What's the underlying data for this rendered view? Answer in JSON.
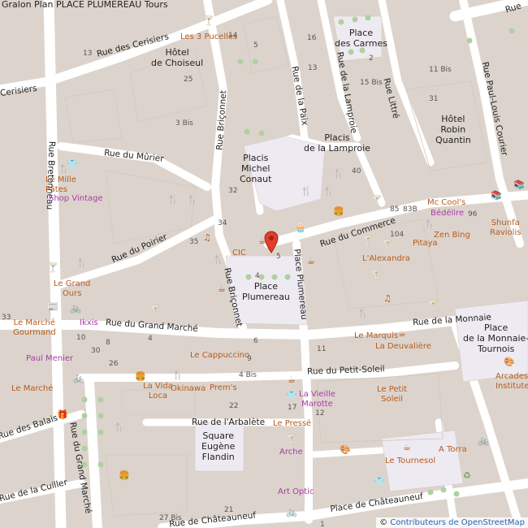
{
  "title": "Gralon Plan PLACE PLUMEREAU Tours",
  "attribution": {
    "prefix": "© ",
    "link": "Contributeurs de OpenStreetMap"
  },
  "colors": {
    "background": "#e0d8d0",
    "street": "#ffffff",
    "plaza": "#eeeaf2",
    "buildingBorder": "#d1c7bd",
    "poi": "#b65b20",
    "shop": "#ac39ac",
    "marker": "#e43e2b"
  },
  "marker": {
    "icon": "map-pin-icon"
  },
  "streets": [
    {
      "id": "rue-des-cerisiers",
      "name": "Rue des Cerisiers"
    },
    {
      "id": "cerisiers-2",
      "name": "Cerisiers"
    },
    {
      "id": "rue-breonneau",
      "name": "Rue Bretonneau"
    },
    {
      "id": "rue-du-murier",
      "name": "Rue du Mûrier"
    },
    {
      "id": "rue-du-poirier",
      "name": "Rue du Poirier"
    },
    {
      "id": "rue-briconnet",
      "name": "Rue Briçonnet"
    },
    {
      "id": "rue-briconnet-2",
      "name": "Rue Briçonnet"
    },
    {
      "id": "rue-de-la-paix",
      "name": "Rue de la Paix"
    },
    {
      "id": "rue-de-la-lamproie",
      "name": "Rue de la Lamproie"
    },
    {
      "id": "rue-littre",
      "name": "Rue Littré"
    },
    {
      "id": "rue-paul-louis-courier",
      "name": "Rue Paul-Louis Courier"
    },
    {
      "id": "rue-du-commerce",
      "name": "Rue du Commerce"
    },
    {
      "id": "place-plumereau-street",
      "name": "Place Plumereau"
    },
    {
      "id": "rue-du-grand-marche",
      "name": "Rue du Grand Marché"
    },
    {
      "id": "rue-de-la-monnaie",
      "name": "Rue de la Monnaie"
    },
    {
      "id": "rue-du-petit-soleil",
      "name": "Rue du Petit-Soleil"
    },
    {
      "id": "rue-de-larbalete",
      "name": "Rue de l'Arbalète"
    },
    {
      "id": "rue-des-balais",
      "name": "Rue des Balais"
    },
    {
      "id": "rue-du-grand-marche-vertical",
      "name": "Rue du Grand Marché"
    },
    {
      "id": "rue-de-la-cuiller",
      "name": "Rue de la Cuiller"
    },
    {
      "id": "rue-chateauneuf-left",
      "name": "Rue de Châteauneuf"
    },
    {
      "id": "place-de-chateauneuf",
      "name": "Place de Châteauneuf"
    },
    {
      "id": "rue-top-right",
      "name": "Rue"
    }
  ],
  "squares": [
    {
      "id": "place-des-carmes",
      "name": "Place\ndes Carmes"
    },
    {
      "id": "hotel-choiseul",
      "name": "Hôtel\nde Choiseul"
    },
    {
      "id": "placis-lamproie",
      "name": "Placis\nde la Lamproie"
    },
    {
      "id": "placis-michel-conaut",
      "name": "Placis\nMichel\nConaut"
    },
    {
      "id": "hotel-robin-quantin",
      "name": "Hôtel\nRobin\nQuantin"
    },
    {
      "id": "place-plumereau",
      "name": "Place\nPlumereau"
    },
    {
      "id": "place-monnaie-tournois",
      "name": "Place\nde la Monnaie-\nTournois"
    },
    {
      "id": "square-eugene-flandin",
      "name": "Square\nEugène\nFlandin"
    }
  ],
  "pois": [
    {
      "id": "les-3-pucelles",
      "name": "Les 3 Pucelles",
      "kind": "food"
    },
    {
      "id": "le-mille-pates",
      "name": "Le Mille\nPâtes",
      "kind": "food"
    },
    {
      "id": "shop-vintage",
      "name": "Shop Vintage",
      "kind": "shop"
    },
    {
      "id": "cic",
      "name": "CIC",
      "kind": "bank"
    },
    {
      "id": "le-grand-ours",
      "name": "Le Grand\nOurs",
      "kind": "food"
    },
    {
      "id": "le-marche-gourmand",
      "name": "Le Marché\nGourmand",
      "kind": "food"
    },
    {
      "id": "ikxis",
      "name": "Ikxis",
      "kind": "shop"
    },
    {
      "id": "paul-menier",
      "name": "Paul Menier",
      "kind": "shop"
    },
    {
      "id": "le-cappuccino",
      "name": "Le Cappuccino",
      "kind": "food"
    },
    {
      "id": "la-vida-loca",
      "name": "La Vida\nLoca",
      "kind": "food"
    },
    {
      "id": "okinawa",
      "name": "Okinawa",
      "kind": "food"
    },
    {
      "id": "prems",
      "name": "Prem's",
      "kind": "food"
    },
    {
      "id": "la-vieille-marotte",
      "name": "La Vieille\nMarotte",
      "kind": "shop"
    },
    {
      "id": "le-presse",
      "name": "Le Pressé",
      "kind": "food"
    },
    {
      "id": "arche",
      "name": "Arche",
      "kind": "shop"
    },
    {
      "id": "art-optic",
      "name": "Art Optic",
      "kind": "shop"
    },
    {
      "id": "le-marche-bottom",
      "name": "Le Marché",
      "kind": "food"
    },
    {
      "id": "le-marquis",
      "name": "Le Marquis",
      "kind": "food"
    },
    {
      "id": "la-deuvaliere",
      "name": "La Deuvalière",
      "kind": "food"
    },
    {
      "id": "le-petit-soleil",
      "name": "Le Petit\nSoleil",
      "kind": "food"
    },
    {
      "id": "le-tournesol",
      "name": "Le Tournesol",
      "kind": "food"
    },
    {
      "id": "a-torra",
      "name": "A Torra",
      "kind": "food"
    },
    {
      "id": "arcades-institute",
      "name": "Arcades\nInstitute",
      "kind": "food"
    },
    {
      "id": "mc-cools",
      "name": "Mc Cool's",
      "kind": "food"
    },
    {
      "id": "bedelire",
      "name": "Bédélire",
      "kind": "shop"
    },
    {
      "id": "pitaya",
      "name": "Pitaya",
      "kind": "food"
    },
    {
      "id": "zen-bing",
      "name": "Zen Bing",
      "kind": "food"
    },
    {
      "id": "shunfa-raviolis",
      "name": "Shunfa\nRaviolis",
      "kind": "food"
    },
    {
      "id": "lalexandra",
      "name": "L'Alexandra",
      "kind": "food"
    }
  ],
  "numbers": [
    "14",
    "13",
    "16",
    "5",
    "2",
    "13",
    "11 Bis",
    "15 Bis",
    "25",
    "31",
    "3 Bis",
    "32",
    "40",
    "34",
    "85",
    "83B",
    "96",
    "104",
    "35",
    "6",
    "10",
    "4",
    "30",
    "26",
    "33",
    "9",
    "4 Bis",
    "22",
    "17",
    "12",
    "11",
    "27 Bis",
    "21",
    "4",
    "5",
    "1",
    "8"
  ]
}
